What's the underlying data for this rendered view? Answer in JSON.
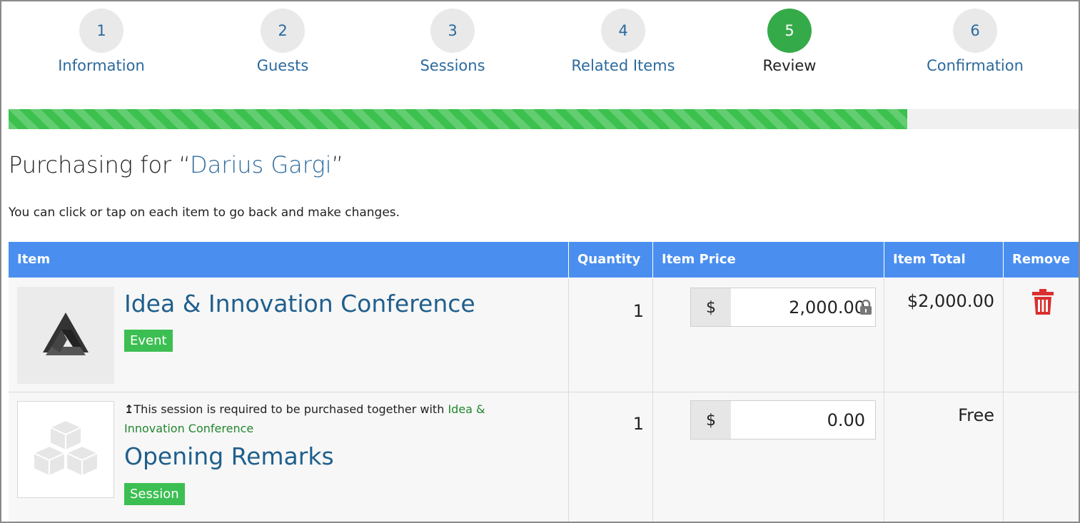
{
  "steps": [
    {
      "number": "1",
      "label": "Information"
    },
    {
      "number": "2",
      "label": "Guests"
    },
    {
      "number": "3",
      "label": "Sessions"
    },
    {
      "number": "4",
      "label": "Related Items"
    },
    {
      "number": "5",
      "label": "Review",
      "active": true
    },
    {
      "number": "6",
      "label": "Confirmation"
    }
  ],
  "progress": {
    "percent": 84
  },
  "header": {
    "prefix": "Purchasing for “",
    "name": "Darius Gargi",
    "suffix": "”",
    "instructions": "You can click or tap on each item to go back and make changes."
  },
  "table": {
    "columns": {
      "item": "Item",
      "quantity": "Quantity",
      "price": "Item Price",
      "total": "Item Total",
      "remove": "Remove"
    },
    "rows": [
      {
        "name": "Idea & Innovation Conference",
        "badge": "Event",
        "quantity": "1",
        "currency": "$",
        "price": "2,000.00",
        "total": "$2,000.00",
        "thumb_icon": "logo-icon"
      },
      {
        "note_icon": "↥",
        "note": "This session is required to be purchased together with ",
        "note_link": "Idea & Innovation Conference",
        "name": "Opening Remarks",
        "badge": "Session",
        "quantity": "1",
        "currency": "$",
        "price": "0.00",
        "total": "Free",
        "thumb_icon": "boxes-icon"
      }
    ]
  },
  "colors": {
    "accent": "#4a8ff0",
    "active_step": "#35aa49",
    "badge": "#3cbf52",
    "link": "#2c6a9c",
    "remove": "#d9302f"
  }
}
